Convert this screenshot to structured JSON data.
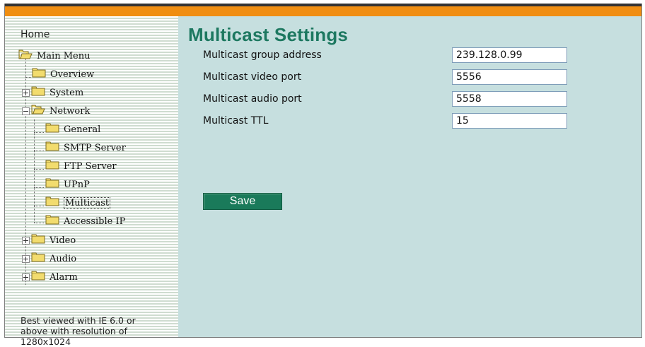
{
  "sidebar": {
    "home": "Home",
    "items": [
      {
        "label": "Main Menu"
      },
      {
        "label": "Overview"
      },
      {
        "label": "System"
      },
      {
        "label": "Network"
      },
      {
        "label": "General"
      },
      {
        "label": "SMTP Server"
      },
      {
        "label": "FTP Server"
      },
      {
        "label": "UPnP"
      },
      {
        "label": "Multicast"
      },
      {
        "label": "Accessible IP"
      },
      {
        "label": "Video"
      },
      {
        "label": "Audio"
      },
      {
        "label": "Alarm"
      }
    ],
    "note_lines": [
      "Best viewed with IE 6.0 or",
      "above with resolution of",
      "1280x1024"
    ]
  },
  "main": {
    "title": "Multicast Settings",
    "fields": [
      {
        "label": "Multicast group address",
        "value": "239.128.0.99"
      },
      {
        "label": "Multicast video port",
        "value": "5556"
      },
      {
        "label": "Multicast audio port",
        "value": "5558"
      },
      {
        "label": "Multicast TTL",
        "value": "15"
      }
    ],
    "save_label": "Save"
  },
  "colors": {
    "top_bar": "#f08e12",
    "main_bg": "#c6dfdf",
    "title": "#1d7860",
    "save_button": "#1a7a5a",
    "folder": "#f2dc6e"
  },
  "icons": {
    "folder": "folder-icon",
    "folder_open": "folder-open-icon",
    "expand": "expand-plus-icon",
    "collapse": "collapse-minus-icon"
  }
}
